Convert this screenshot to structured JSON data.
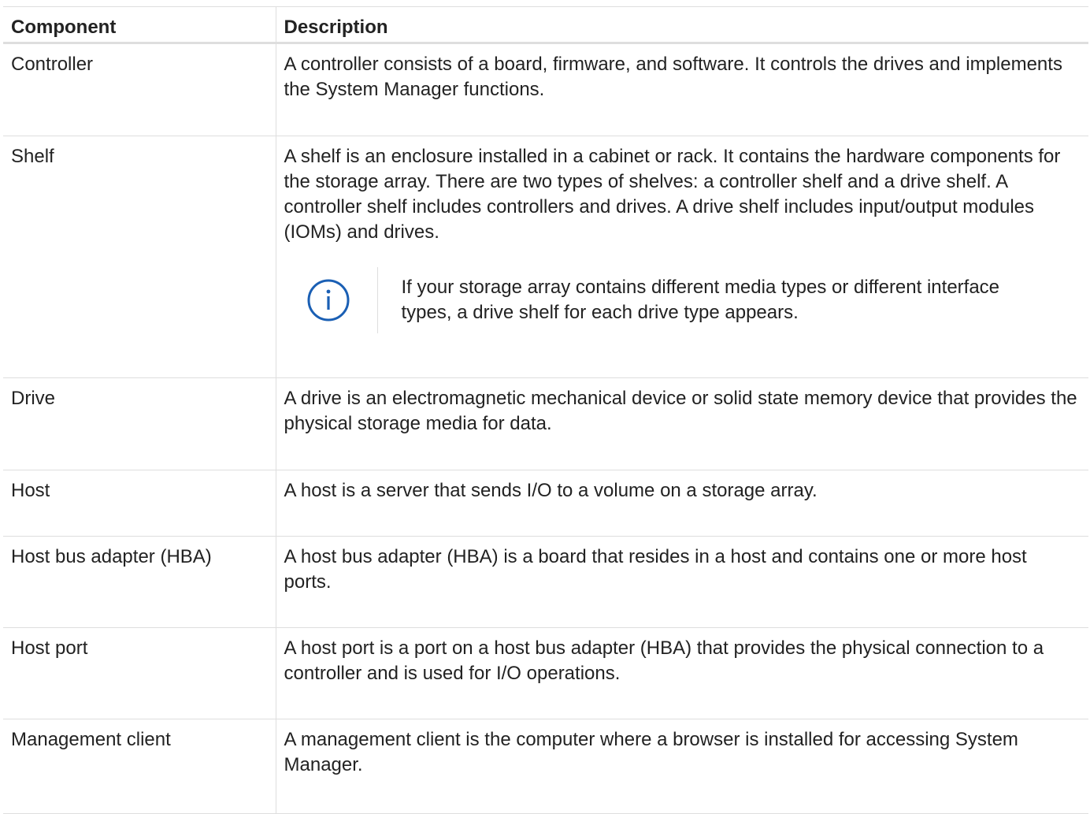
{
  "table": {
    "headers": {
      "component": "Component",
      "description": "Description"
    },
    "rows": [
      {
        "component": "Controller",
        "description": "A controller consists of a board, firmware, and software. It controls the drives and implements the System Manager functions."
      },
      {
        "component": "Shelf",
        "description": "A shelf is an enclosure installed in a cabinet or rack. It contains the hardware components for the storage array. There are two types of shelves: a controller shelf and a drive shelf. A controller shelf includes controllers and drives. A drive shelf includes input/output modules (IOMs) and drives.",
        "note": {
          "icon": "info-icon",
          "text": "If your storage array contains different media types or different interface types, a drive shelf for each drive type appears."
        }
      },
      {
        "component": "Drive",
        "description": "A drive is an electromagnetic mechanical device or solid state memory device that provides the physical storage media for data."
      },
      {
        "component": "Host",
        "description": "A host is a server that sends I/O to a volume on a storage array."
      },
      {
        "component": "Host bus adapter (HBA)",
        "description": "A host bus adapter (HBA) is a board that resides in a host and contains one or more host ports."
      },
      {
        "component": "Host port",
        "description": "A host port is a port on a host bus adapter (HBA) that provides the physical connection to a controller and is used for I/O operations."
      },
      {
        "component": "Management client",
        "description": "A management client is the computer where a browser is installed for accessing System Manager."
      }
    ]
  },
  "colors": {
    "info_icon": "#1a5fb4",
    "border": "#dedede",
    "text": "#222222"
  }
}
